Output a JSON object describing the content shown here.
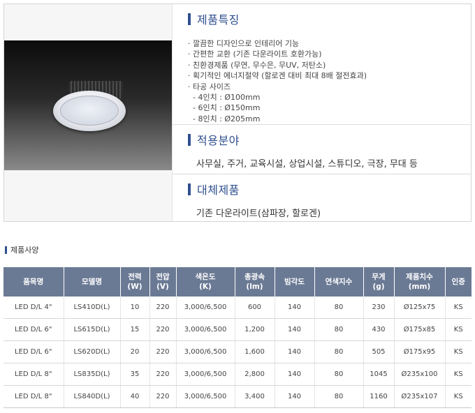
{
  "features": {
    "title": "제품특징",
    "items": [
      "· 깔끔한 디자인으로 인테리어 기능",
      "· 간편한 교환 (기존 다운라이트 호환가능)",
      "· 친환경제품 (무연, 무수은, 무UV, 저탄소)",
      "· 획기적인 에너지절약 (할로겐 대비 최대 8배 절전효과)",
      "· 타공 사이즈",
      "  - 4인치 : Ø100mm",
      "  - 6인치 : Ø150mm",
      "  - 8인치 : Ø205mm"
    ]
  },
  "applications": {
    "title": "적용분야",
    "text": "사무실, 주거, 교육시설, 상업시설, 스튜디오, 극장, 무대 등"
  },
  "replacement": {
    "title": "대체제품",
    "text": "기존 다운라이트(삼파장, 할로겐)"
  },
  "spec": {
    "title": "제품사양",
    "headers": [
      [
        "품목명"
      ],
      [
        "모델명"
      ],
      [
        "전력",
        "(W)"
      ],
      [
        "전압",
        "(V)"
      ],
      [
        "색온도",
        "(K)"
      ],
      [
        "총광속",
        "(lm)"
      ],
      [
        "빔각도"
      ],
      [
        "연색지수"
      ],
      [
        "무게",
        "(g)"
      ],
      [
        "제품치수",
        "(mm)"
      ],
      [
        "인증"
      ]
    ],
    "rows": [
      [
        "LED D/L 4\"",
        "LS410D(L)",
        "10",
        "220",
        "3,000/6,500",
        "600",
        "140",
        "80",
        "230",
        "Ø125x75",
        "KS"
      ],
      [
        "LED D/L 6\"",
        "LS615D(L)",
        "15",
        "220",
        "3,000/6,500",
        "1,200",
        "140",
        "80",
        "430",
        "Ø175x85",
        "KS"
      ],
      [
        "LED D/L 6\"",
        "LS620D(L)",
        "20",
        "220",
        "3,000/6,500",
        "1,600",
        "140",
        "80",
        "505",
        "Ø175x95",
        "KS"
      ],
      [
        "LED D/L 8\"",
        "LS835D(L)",
        "35",
        "220",
        "3,000/6,500",
        "2,800",
        "140",
        "80",
        "1045",
        "Ø235x100",
        "KS"
      ],
      [
        "LED D/L 8\"",
        "LS840D(L)",
        "40",
        "220",
        "3,000/6,500",
        "3,400",
        "140",
        "80",
        "1160",
        "Ø235x107",
        "KS"
      ]
    ]
  },
  "icons": {
    "section_marker": "bar-icon",
    "product_image": "led-downlight-photo"
  },
  "colors": {
    "accent": "#2f4f8f",
    "table_header": "#6b7a94"
  }
}
